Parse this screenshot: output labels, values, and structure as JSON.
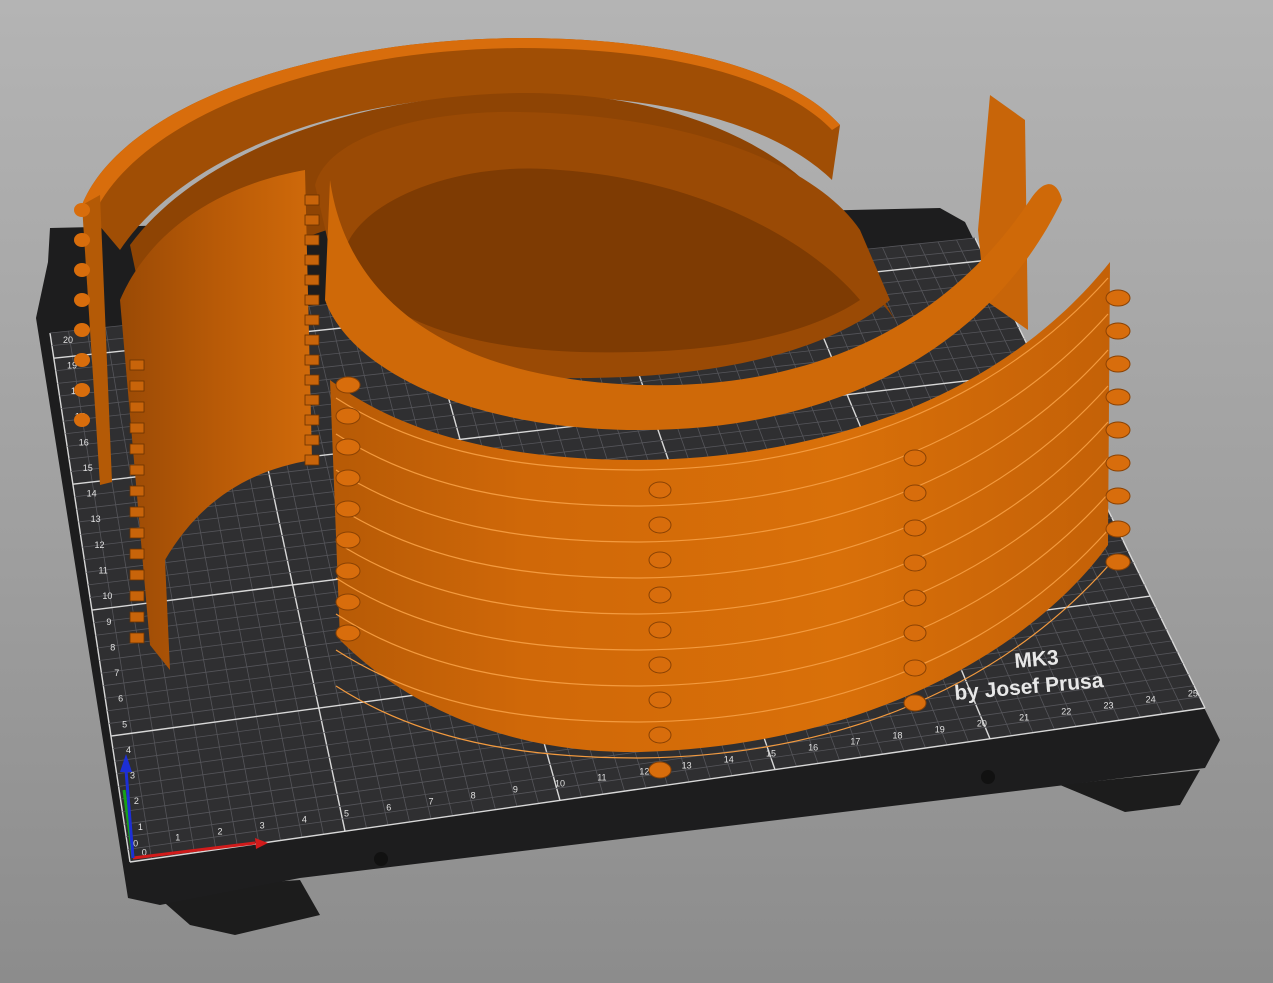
{
  "app": {
    "view": "3D plater"
  },
  "bed": {
    "label_line1": "MK3",
    "label_line2": "by Josef Prusa",
    "x_ticks": [
      "0",
      "1",
      "2",
      "3",
      "4",
      "5",
      "6",
      "7",
      "8",
      "9",
      "10",
      "11",
      "12",
      "13",
      "14",
      "15",
      "16",
      "17",
      "18",
      "19",
      "20",
      "21",
      "22",
      "23",
      "24",
      "25"
    ],
    "y_ticks": [
      "0",
      "1",
      "2",
      "3",
      "4",
      "5",
      "6",
      "7",
      "8",
      "9",
      "10",
      "11",
      "12",
      "13",
      "14",
      "15",
      "16",
      "17",
      "18",
      "19",
      "20"
    ]
  },
  "model": {
    "name": "stacked face shield headbands",
    "color": "#d86d0c",
    "shade_color": "#a04e05",
    "dark_color": "#7a3a02"
  },
  "colors": {
    "bed_surface": "#2f2f31",
    "bed_edge": "#161616",
    "grid_line": "#56565a",
    "grid_major": "#e6e6e6",
    "axis_x": "#d11b1b",
    "axis_y": "#18a018",
    "axis_z": "#1c2fd6"
  },
  "icons": {
    "axes": "axes-gizmo-icon"
  }
}
